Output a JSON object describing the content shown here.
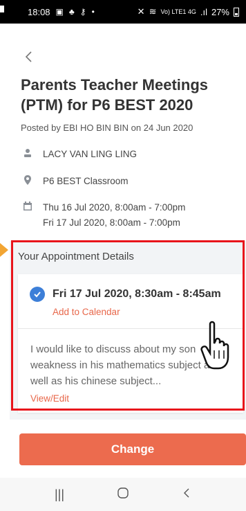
{
  "status_bar": {
    "time": "18:08",
    "left_icons": [
      "gallery-icon",
      "app-icon",
      "key-icon",
      "dot-icon"
    ],
    "network": "Vo) LTE1 4G",
    "battery": "27%"
  },
  "page": {
    "title": "Parents Teacher Meetings (PTM) for P6 BEST 2020",
    "posted": "Posted by EBI HO BIN BIN on 24 Jun 2020",
    "teacher": "LACY VAN LING LING",
    "location": "P6 BEST Classroom",
    "dates": [
      "Thu 16 Jul 2020, 8:00am - 7:00pm",
      "Fri 17 Jul 2020, 8:00am - 7:00pm"
    ]
  },
  "appointment": {
    "section_title": "Your Appointment Details",
    "time": "Fri 17 Jul 2020, 8:30am - 8:45am",
    "add_to_calendar": "Add to Calendar",
    "note": "I would like to discuss about my son weakness in his mathematics subject as well as his chinese subject...",
    "view_edit": "View/Edit"
  },
  "actions": {
    "change": "Change"
  },
  "colors": {
    "accent": "#ec6b4e",
    "link": "#e8674a",
    "check": "#3d7fd8",
    "highlight": "#e8141b"
  }
}
